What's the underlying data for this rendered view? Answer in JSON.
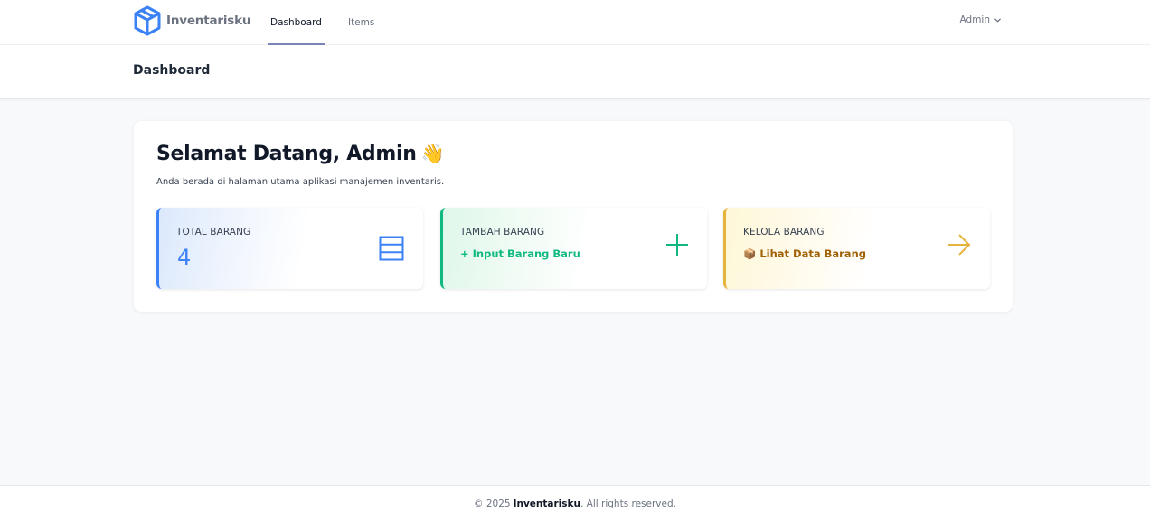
{
  "brand": {
    "name": "Inventarisku",
    "logo_icon": "cube-icon",
    "accent": "#3b82f6"
  },
  "nav": {
    "links": [
      {
        "label": "Dashboard",
        "active": true
      },
      {
        "label": "Items",
        "active": false
      }
    ],
    "user": {
      "name": "Admin",
      "icon": "chevron-down-icon"
    }
  },
  "page_header": {
    "title": "Dashboard"
  },
  "welcome": {
    "title": "Selamat Datang, Admin",
    "emoji": "👋",
    "subtitle": "Anda berada di halaman utama aplikasi manajemen inventaris."
  },
  "cards": [
    {
      "label": "TOTAL BARANG",
      "value": "4",
      "icon": "table-rows-icon",
      "color": "#3b82f6"
    },
    {
      "label": "TAMBAH BARANG",
      "link": "+ Input Barang Baru",
      "icon": "plus-icon",
      "color": "#10b981"
    },
    {
      "label": "KELOLA BARANG",
      "link": "📦 Lihat Data Barang",
      "icon": "arrow-right-icon",
      "color": "#e5b43c"
    }
  ],
  "footer": {
    "prefix": "© 2025",
    "brand": "Inventarisku",
    "suffix": ". All rights reserved."
  }
}
